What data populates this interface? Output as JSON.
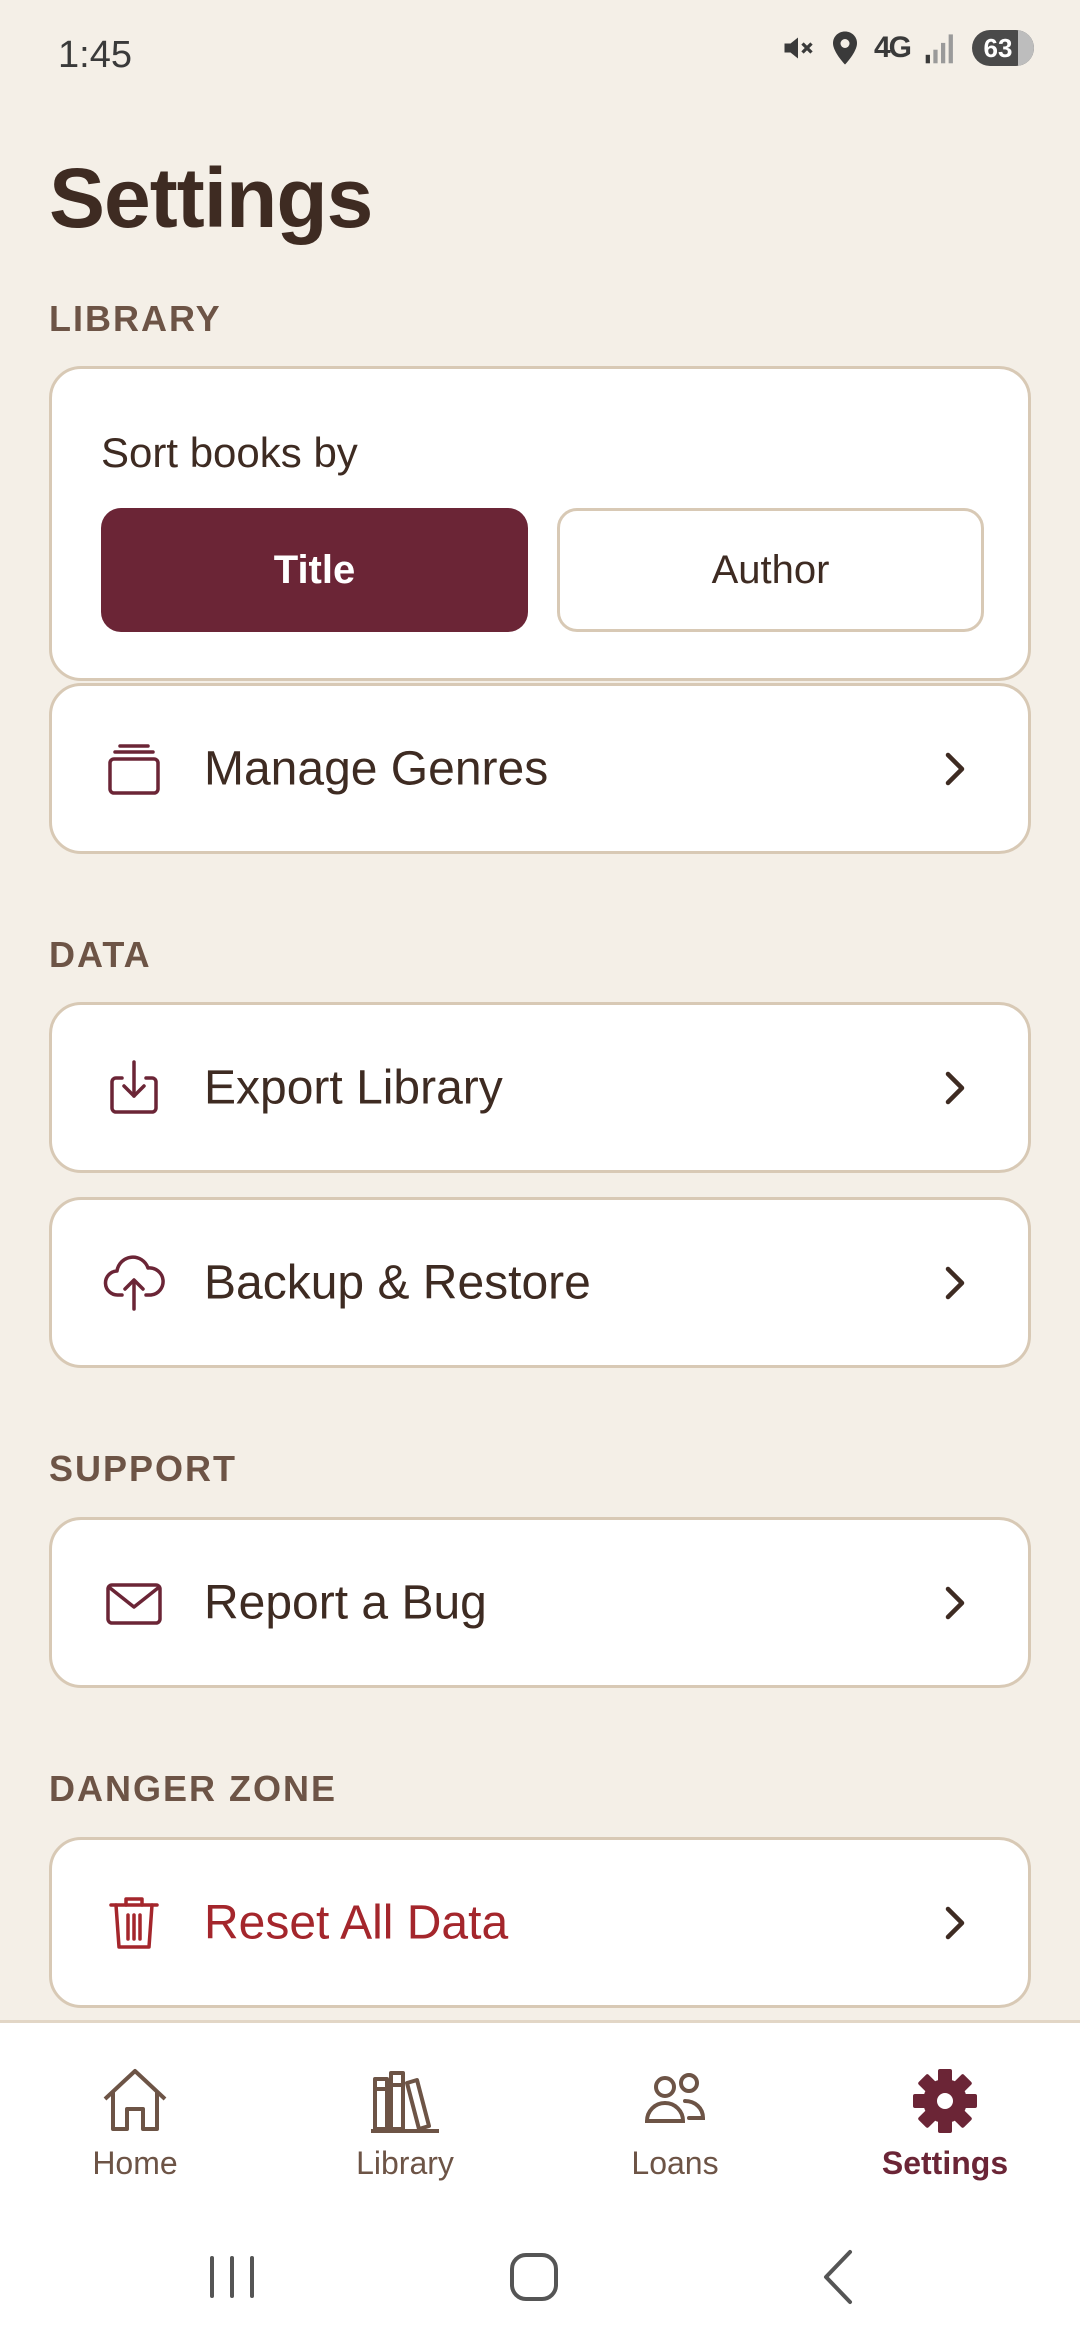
{
  "status_bar": {
    "time": "1:45",
    "network": "4G",
    "battery": "63",
    "icons": [
      "mute-icon",
      "location-icon",
      "signal-icon",
      "battery-icon"
    ]
  },
  "page": {
    "title": "Settings"
  },
  "sections": {
    "library": "LIBRARY",
    "data": "DATA",
    "support": "SUPPORT",
    "danger": "DANGER ZONE"
  },
  "sort": {
    "label": "Sort books by",
    "options": [
      "Title",
      "Author"
    ],
    "selected": "Title"
  },
  "rows": {
    "manage_genres": {
      "label": "Manage Genres",
      "icon": "stack-icon"
    },
    "export_library": {
      "label": "Export Library",
      "icon": "download-icon"
    },
    "backup_restore": {
      "label": "Backup & Restore",
      "icon": "cloud-upload-icon"
    },
    "report_bug": {
      "label": "Report a Bug",
      "icon": "mail-icon"
    },
    "reset_data": {
      "label": "Reset All Data",
      "icon": "trash-icon"
    }
  },
  "bottom_nav": {
    "items": [
      {
        "label": "Home",
        "icon": "home-icon"
      },
      {
        "label": "Library",
        "icon": "books-icon"
      },
      {
        "label": "Loans",
        "icon": "people-icon"
      },
      {
        "label": "Settings",
        "icon": "gear-icon"
      }
    ],
    "active": "Settings"
  },
  "colors": {
    "background": "#f4efe7",
    "accent": "#6b2536",
    "danger": "#a4262c",
    "text": "#3e2b22",
    "section_label": "#6d5446",
    "card_border": "#d8c9b5"
  }
}
